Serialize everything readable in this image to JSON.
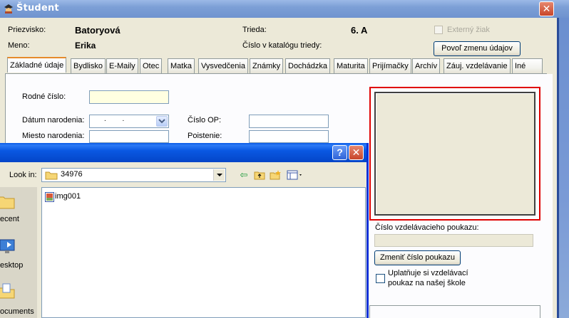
{
  "window": {
    "title": "Študent",
    "close_glyph": "✕"
  },
  "header": {
    "surname_label": "Priezvisko:",
    "surname_value": "Batoryová",
    "name_label": "Meno:",
    "name_value": "Erika",
    "class_label": "Trieda:",
    "class_value": "6. A",
    "catalog_label": "Číslo v katalógu triedy:",
    "external_label": "Externý žiak",
    "allow_change_button": "Povoľ zmenu údajov"
  },
  "tabs": [
    {
      "label": "Základné údaje",
      "active": true
    },
    {
      "label": "Bydlisko"
    },
    {
      "label": "E-Maily"
    },
    {
      "label": "Otec"
    },
    {
      "label": "Matka"
    },
    {
      "label": "Vysvedčenia"
    },
    {
      "label": "Známky"
    },
    {
      "label": "Dochádzka"
    },
    {
      "label": "Maturita"
    },
    {
      "label": "Prijímačky"
    },
    {
      "label": "Archív"
    },
    {
      "label": "Záuj. vzdelávanie"
    },
    {
      "label": "Iné"
    }
  ],
  "form": {
    "birth_number_label": "Rodné číslo:",
    "birth_date_label": "Dátum narodenia:",
    "birth_date_value": ". .",
    "birthplace_label": "Miesto narodenia:",
    "id_card_label": "Číslo OP:",
    "insurance_label": "Poistenie:"
  },
  "voucher": {
    "number_label": "Číslo vzdelávacieho poukazu:",
    "change_button": "Zmeniť číslo poukazu",
    "applies_label_line1": "Uplatňuje si vzdelávací",
    "applies_label_line2": "poukaz na našej škole"
  },
  "file_dialog": {
    "help_glyph": "?",
    "close_glyph": "✕",
    "look_in_label": "Look in:",
    "look_in_value": "34976",
    "files": [
      "img001"
    ],
    "places": [
      "ecent",
      "esktop",
      "ocuments"
    ]
  },
  "colors": {
    "titlebar": "#7c9fd6",
    "dialog_titlebar": "#0a58e2",
    "photo_highlight": "#e00000",
    "active_tab_accent": "#e68b2c"
  }
}
